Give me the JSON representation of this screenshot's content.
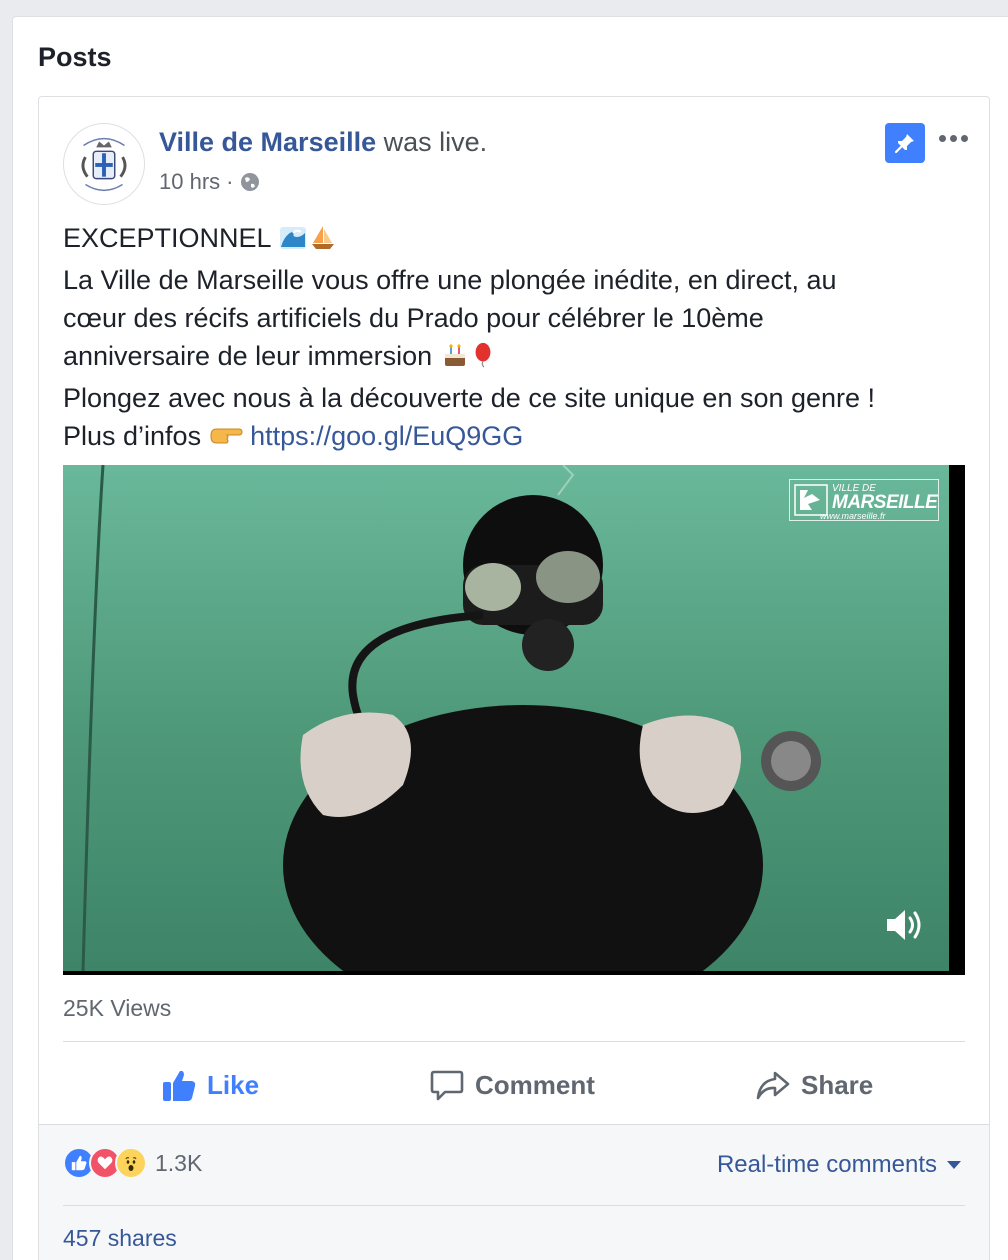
{
  "section": {
    "title": "Posts"
  },
  "post": {
    "author": "Ville de Marseille",
    "action_text": "was live.",
    "time": "10 hrs",
    "separator": "·",
    "text_lines": [
      "EXCEPTIONNEL",
      "La Ville de Marseille vous offre une plongée inédite, en direct, au",
      "cœur des récifs artificiels du Prado pour célébrer le 10ème",
      "anniversaire de leur immersion",
      "Plongez avec nous à la découverte de ce site unique en son genre !",
      "Plus d’infos"
    ],
    "emojis": [
      "wave-emoji",
      "sailboat-emoji",
      "cake-emoji",
      "balloon-emoji",
      "pointing-hand-emoji"
    ],
    "link": "https://goo.gl/EuQ9GG",
    "video": {
      "watermark_top": "VILLE DE",
      "watermark_main": "MARSEILLE",
      "watermark_url": "www.marseille.fr"
    },
    "views": "25K Views",
    "actions": {
      "like": "Like",
      "comment": "Comment",
      "share": "Share"
    },
    "reaction_count": "1.3K",
    "realtime_comments": "Real-time comments",
    "shares": "457 shares"
  },
  "colors": {
    "link_blue": "#365899",
    "like_blue": "#4080ff",
    "love_red": "#f25268",
    "wow_yellow": "#fcd45b",
    "water_green": "#4f9a7a"
  }
}
